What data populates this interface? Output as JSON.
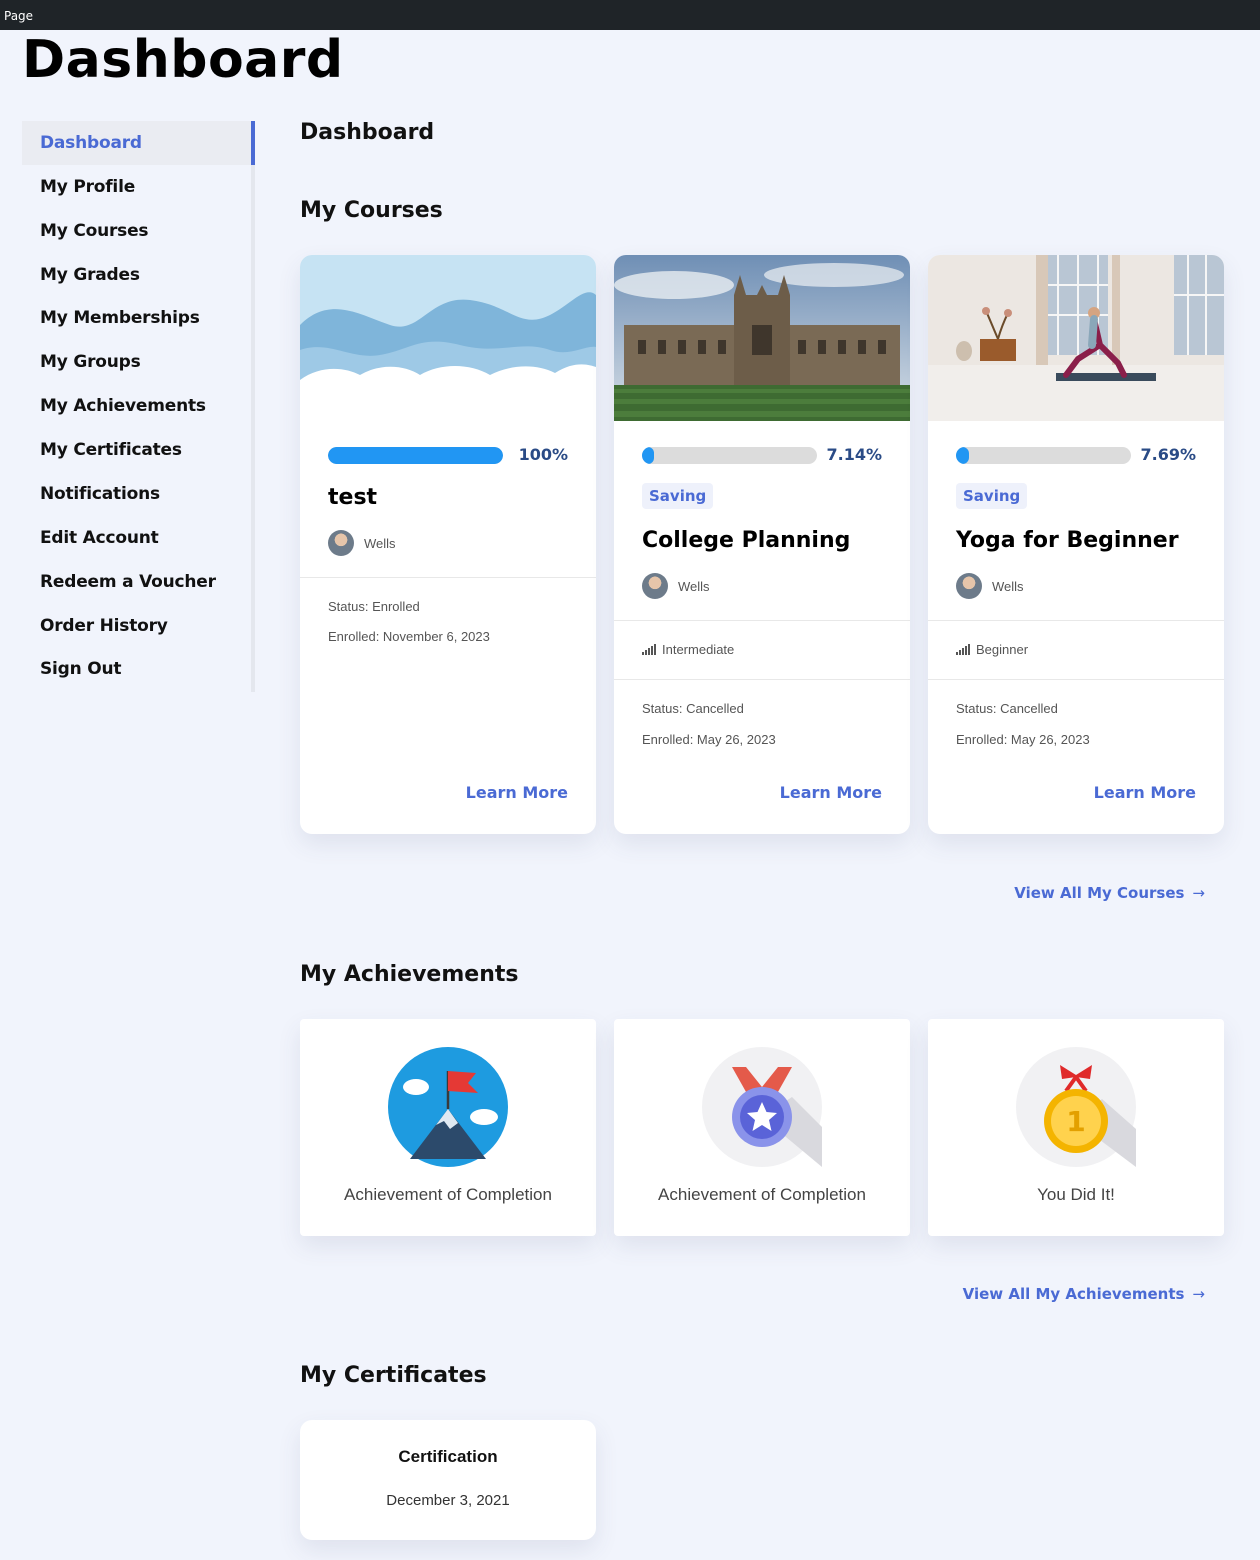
{
  "window": {
    "title": "Page"
  },
  "page_title": "Dashboard",
  "sidebar": {
    "items": [
      {
        "label": "Dashboard",
        "active": true
      },
      {
        "label": "My Profile"
      },
      {
        "label": "My Courses"
      },
      {
        "label": "My Grades"
      },
      {
        "label": "My Memberships"
      },
      {
        "label": "My Groups"
      },
      {
        "label": "My Achievements"
      },
      {
        "label": "My Certificates"
      },
      {
        "label": "Notifications"
      },
      {
        "label": "Edit Account"
      },
      {
        "label": "Redeem a Voucher"
      },
      {
        "label": "Order History"
      },
      {
        "label": "Sign Out"
      }
    ]
  },
  "main": {
    "heading": "Dashboard",
    "courses_heading": "My Courses",
    "courses": [
      {
        "title": "test",
        "progress_label": "100%",
        "progress": 1.0,
        "author": "Wells",
        "status": "Status: Enrolled",
        "enrolled": "Enrolled: November 6, 2023",
        "cta": "Learn More",
        "image": "clouds-illustration"
      },
      {
        "title": "College Planning",
        "progress_label": "7.14%",
        "progress": 0.0714,
        "tag": "Saving",
        "author": "Wells",
        "level": "Intermediate",
        "status": "Status: Cancelled",
        "enrolled": "Enrolled: May 26, 2023",
        "cta": "Learn More",
        "image": "college-building-photo"
      },
      {
        "title": "Yoga for Beginner",
        "progress_label": "7.69%",
        "progress": 0.0769,
        "tag": "Saving",
        "author": "Wells",
        "level": "Beginner",
        "status": "Status: Cancelled",
        "enrolled": "Enrolled: May 26, 2023",
        "cta": "Learn More",
        "image": "yoga-room-photo"
      }
    ],
    "view_all_courses": "View All My Courses",
    "achievements_heading": "My Achievements",
    "achievements": [
      {
        "label": "Achievement of Completion",
        "icon": "mountain-flag-icon"
      },
      {
        "label": "Achievement of Completion",
        "icon": "medal-star-icon"
      },
      {
        "label": "You Did It!",
        "icon": "gold-medal-icon"
      }
    ],
    "view_all_achievements": "View All My Achievements",
    "certificates_heading": "My Certificates",
    "certificates": [
      {
        "title": "Certification",
        "date": "December 3, 2021"
      }
    ],
    "arrow": "→"
  },
  "colors": {
    "accent": "#4a6ad4",
    "progress": "#2196f3",
    "percent": "#2a4b86",
    "background": "#f1f4fc"
  }
}
